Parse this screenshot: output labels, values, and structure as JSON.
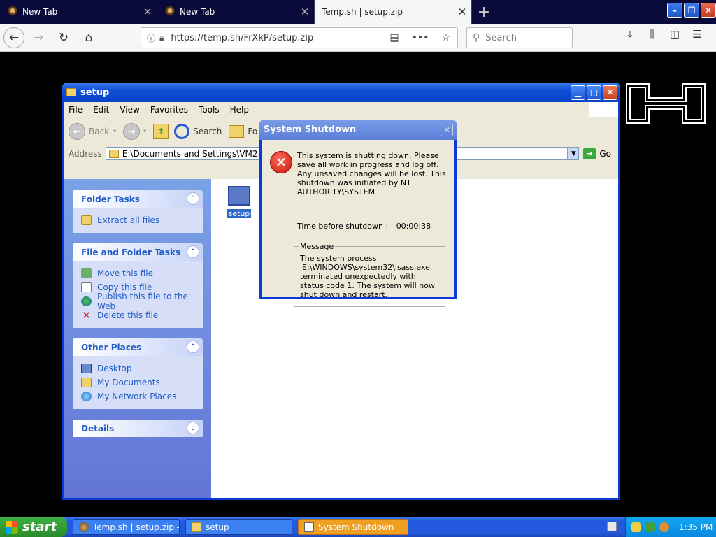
{
  "browser": {
    "tabs": [
      {
        "label": "New Tab",
        "active": false
      },
      {
        "label": "New Tab",
        "active": false
      },
      {
        "label": "Temp.sh | setup.zip",
        "active": true
      }
    ],
    "url": "https://temp.sh/FrXkP/setup.zip",
    "search_placeholder": "Search",
    "win_buttons": {
      "minimize": "–",
      "restore": "❐",
      "close": "✕"
    }
  },
  "explorer": {
    "title": "setup",
    "menu": [
      "File",
      "Edit",
      "View",
      "Favorites",
      "Tools",
      "Help"
    ],
    "toolbar": {
      "back": "Back",
      "search": "Search",
      "folders": "Fo"
    },
    "address_label": "Address",
    "address_value": "E:\\Documents and Settings\\VM2.COLLABNE",
    "go_label": "Go",
    "panels": [
      {
        "title": "Folder Tasks",
        "chevron": "up",
        "items": [
          {
            "icon": "zip-icon",
            "label": "Extract all files"
          }
        ]
      },
      {
        "title": "File and Folder Tasks",
        "chevron": "up",
        "items": [
          {
            "icon": "move-icon",
            "label": "Move this file"
          },
          {
            "icon": "copy-icon",
            "label": "Copy this file"
          },
          {
            "icon": "web-icon",
            "label": "Publish this file to the Web"
          },
          {
            "icon": "delete-icon",
            "label": "Delete this file"
          }
        ]
      },
      {
        "title": "Other Places",
        "chevron": "up",
        "items": [
          {
            "icon": "desktop-icon",
            "label": "Desktop"
          },
          {
            "icon": "documents-icon",
            "label": "My Documents"
          },
          {
            "icon": "network-icon",
            "label": "My Network Places"
          }
        ]
      },
      {
        "title": "Details",
        "chevron": "down",
        "items": []
      }
    ],
    "file": {
      "name": "setup"
    }
  },
  "dialog": {
    "title": "System Shutdown",
    "message": "This system is shutting down. Please save all work in progress and log off. Any unsaved changes will be lost. This shutdown was initiated by NT AUTHORITY\\SYSTEM",
    "time_label": "Time before shutdown :",
    "time_value": "00:00:38",
    "message_group_label": "Message",
    "message_detail": "The system process 'E:\\WINDOWS\\system32\\lsass.exe' terminated unexpectedly with status code 1.  The system will now shut down and restart."
  },
  "taskbar": {
    "start_label": "start",
    "tasks": [
      {
        "label": "Temp.sh | setup.zip -...",
        "icon": "firefox-icon",
        "active": false
      },
      {
        "label": "setup",
        "icon": "folder-icon",
        "active": false
      },
      {
        "label": "System Shutdown",
        "icon": "window-icon",
        "active": true
      }
    ],
    "clock": "1:35 PM"
  },
  "colors": {
    "xp_blue": "#0a3ad8",
    "dialog_inactive_title": "#6b8ce0",
    "active_task": "#f0a020"
  }
}
